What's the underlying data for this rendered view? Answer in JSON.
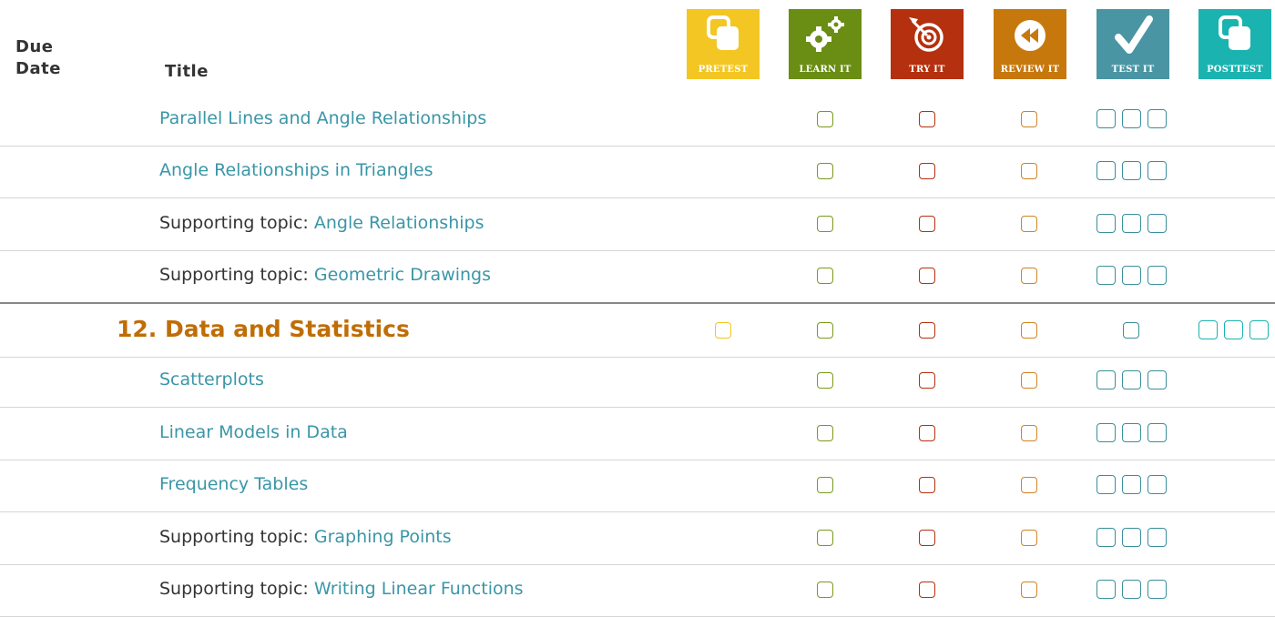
{
  "header": {
    "due_date_line1": "Due",
    "due_date_line2": "Date",
    "title_label": "Title",
    "columns": [
      {
        "key": "pretest",
        "label": "PRETEST",
        "icon": "pretest-icon",
        "color": "#f3c623"
      },
      {
        "key": "learn",
        "label": "LEARN IT",
        "icon": "gears-icon",
        "color": "#6a8d14"
      },
      {
        "key": "try",
        "label": "TRY IT",
        "icon": "target-icon",
        "color": "#b5300e"
      },
      {
        "key": "review",
        "label": "REVIEW IT",
        "icon": "rewind-icon",
        "color": "#c7780d"
      },
      {
        "key": "test",
        "label": "TEST IT",
        "icon": "checkmark-icon",
        "color": "#4a95a3"
      },
      {
        "key": "posttest",
        "label": "POSTTEST",
        "icon": "posttest-icon",
        "color": "#1ab3b0"
      }
    ]
  },
  "colors": {
    "link": "#3a96a7",
    "section_title": "#c06d06",
    "checkbox_pretest": "#f3c623",
    "checkbox_learn": "#7a9a1a",
    "checkbox_try": "#b5300e",
    "checkbox_review": "#d08420",
    "checkbox_test": "#3a8f9c",
    "checkbox_posttest": "#1ab3b0"
  },
  "rows": [
    {
      "type": "topic",
      "prefix": "",
      "title": "Parallel Lines and Angle Relationships"
    },
    {
      "type": "topic",
      "prefix": "",
      "title": "Angle Relationships in Triangles"
    },
    {
      "type": "topic",
      "prefix": "Supporting topic: ",
      "title": "Angle Relationships"
    },
    {
      "type": "topic",
      "prefix": "Supporting topic: ",
      "title": "Geometric Drawings"
    },
    {
      "type": "section",
      "title": "12. Data and Statistics"
    },
    {
      "type": "topic",
      "prefix": "",
      "title": "Scatterplots"
    },
    {
      "type": "topic",
      "prefix": "",
      "title": "Linear Models in Data"
    },
    {
      "type": "topic",
      "prefix": "",
      "title": "Frequency Tables"
    },
    {
      "type": "topic",
      "prefix": "Supporting topic: ",
      "title": "Graphing Points"
    },
    {
      "type": "topic",
      "prefix": "Supporting topic: ",
      "title": "Writing Linear Functions"
    }
  ]
}
